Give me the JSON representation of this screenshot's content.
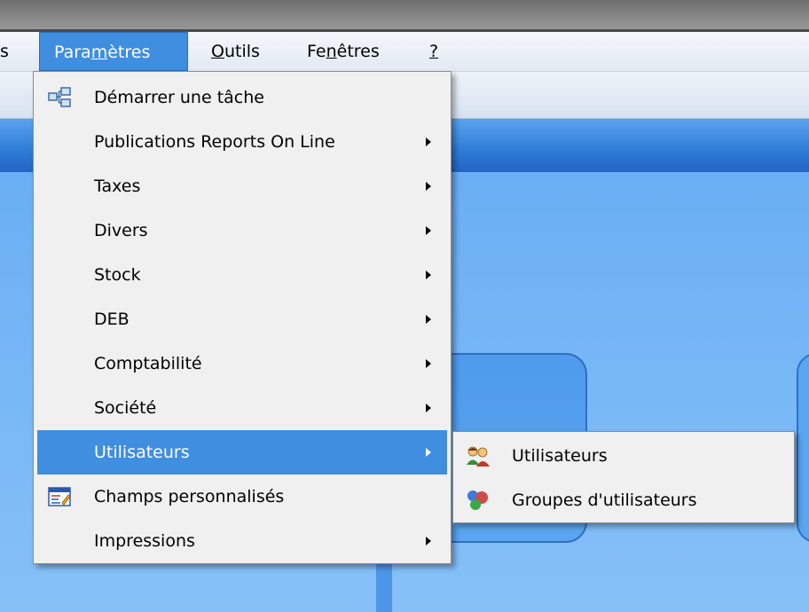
{
  "menubar": {
    "partial_left": "s",
    "items": [
      {
        "label_pre": "Para",
        "label_ul": "m",
        "label_post": "ètres"
      },
      {
        "label_pre": "",
        "label_ul": "O",
        "label_post": "utils"
      },
      {
        "label_pre": "Fe",
        "label_ul": "n",
        "label_post": "êtres"
      },
      {
        "label_pre": "",
        "label_ul": "?",
        "label_post": ""
      }
    ]
  },
  "menu": {
    "items": [
      {
        "label": "Démarrer une tâche",
        "icon": "tree-structure-icon",
        "submenu": false
      },
      {
        "label": "Publications Reports On Line",
        "submenu": true
      },
      {
        "label": "Taxes",
        "submenu": true
      },
      {
        "label": "Divers",
        "submenu": true
      },
      {
        "label": "Stock",
        "submenu": true
      },
      {
        "label": "DEB",
        "submenu": true
      },
      {
        "label": "Comptabilité",
        "submenu": true
      },
      {
        "label": "Société",
        "submenu": true
      },
      {
        "label": "Utilisateurs",
        "submenu": true,
        "highlighted": true
      },
      {
        "label": "Champs personnalisés",
        "icon": "custom-fields-icon",
        "submenu": false
      },
      {
        "label": "Impressions",
        "submenu": true
      }
    ]
  },
  "submenu": {
    "items": [
      {
        "label": "Utilisateurs",
        "icon": "users-icon"
      },
      {
        "label": "Groupes d'utilisateurs",
        "icon": "user-groups-icon"
      }
    ]
  },
  "colors": {
    "highlight": "#3f8ee0",
    "menu_bg": "#f0f0f0",
    "app_blue": "#70b2f4"
  }
}
